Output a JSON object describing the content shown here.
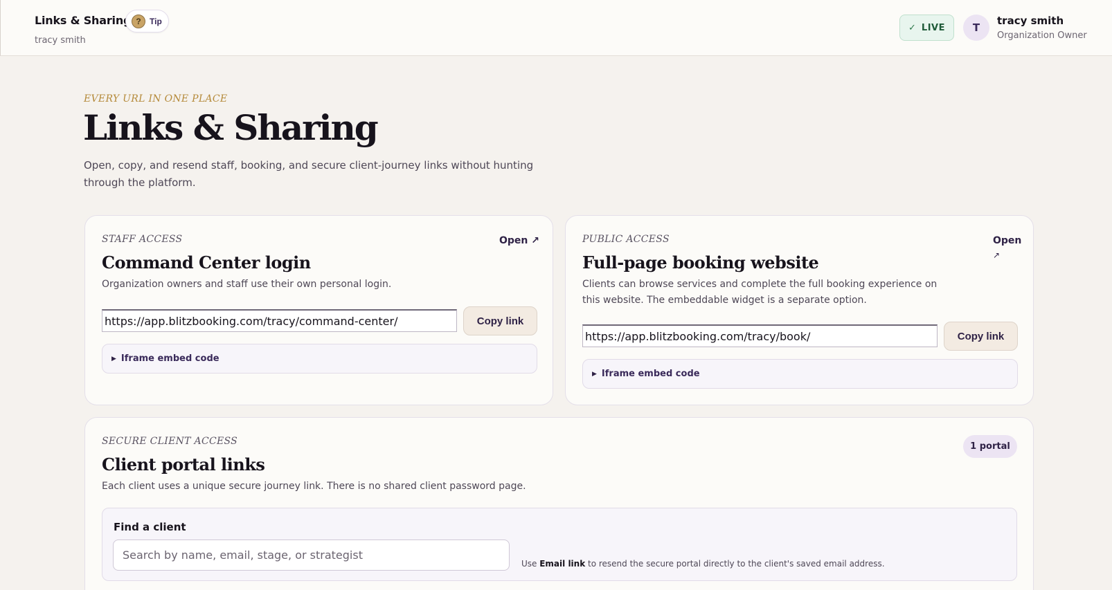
{
  "header": {
    "title": "Links & Sharing",
    "subtitle": "tracy smith",
    "tip_icon": "?",
    "tip_label": "Tip",
    "live_check": "✓",
    "live_label": "LIVE",
    "avatar_initial": "T",
    "user_name": "tracy smith",
    "user_role": "Organization Owner"
  },
  "hero": {
    "eyebrow": "EVERY URL IN ONE PLACE",
    "title": "Links & Sharing",
    "description": "Open, copy, and resend staff, booking, and secure client-journey links without hunting through the platform."
  },
  "staff_card": {
    "eyebrow": "STAFF ACCESS",
    "title": "Command Center login",
    "description": "Organization owners and staff use their own personal login.",
    "open_label": "Open ↗",
    "url": "https://app.blitzbooking.com/tracy/command-center/",
    "copy_label": "Copy link",
    "embed_label": "Iframe embed code"
  },
  "public_card": {
    "eyebrow": "PUBLIC ACCESS",
    "title": "Full-page booking website",
    "description": "Clients can browse services and complete the full booking experience on this website. The embeddable widget is a separate option.",
    "open_label": "Open",
    "open_arrow": "↗",
    "url": "https://app.blitzbooking.com/tracy/book/",
    "copy_label": "Copy link",
    "embed_label": "Iframe embed code"
  },
  "client_card": {
    "eyebrow": "SECURE CLIENT ACCESS",
    "title": "Client portal links",
    "description": "Each client uses a unique secure journey link. There is no shared client password page.",
    "badge": "1 portal",
    "find_label": "Find a client",
    "search_placeholder": "Search by name, email, stage, or strategist",
    "hint_prefix": "Use ",
    "hint_bold": "Email link",
    "hint_suffix": " to resend the secure portal directly to the client's saved email address."
  }
}
